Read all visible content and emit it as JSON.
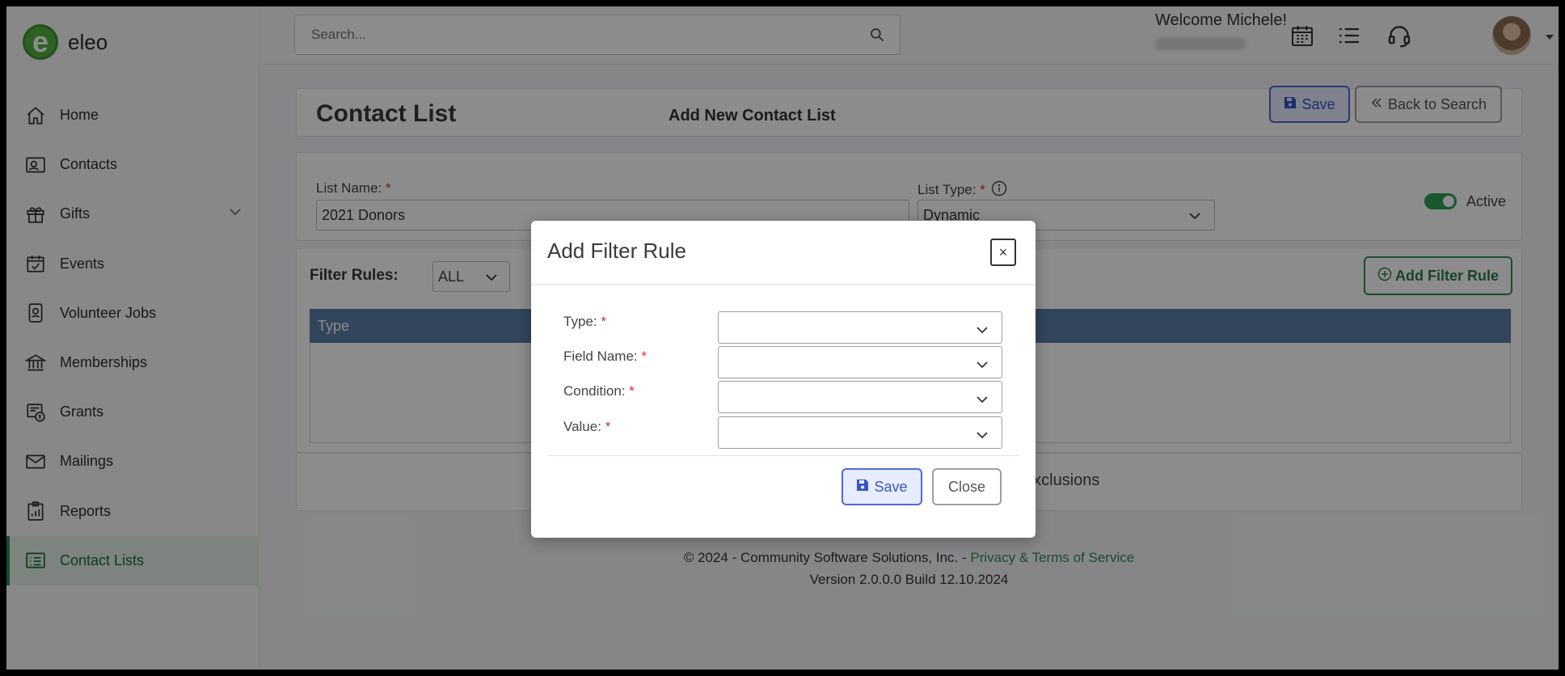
{
  "header": {
    "search_placeholder": "Search...",
    "welcome": "Welcome Michele!"
  },
  "brand": {
    "name": "eleo",
    "mark": "e"
  },
  "sidebar": {
    "items": [
      {
        "label": "Home",
        "icon": "home-icon"
      },
      {
        "label": "Contacts",
        "icon": "contacts-icon"
      },
      {
        "label": "Gifts",
        "icon": "gift-icon"
      },
      {
        "label": "Events",
        "icon": "calendar-check-icon"
      },
      {
        "label": "Volunteer Jobs",
        "icon": "id-badge-icon"
      },
      {
        "label": "Memberships",
        "icon": "bank-icon"
      },
      {
        "label": "Grants",
        "icon": "grant-icon"
      },
      {
        "label": "Mailings",
        "icon": "envelope-icon"
      },
      {
        "label": "Reports",
        "icon": "clipboard-chart-icon"
      },
      {
        "label": "Contact Lists",
        "icon": "list-icon"
      }
    ]
  },
  "page": {
    "title": "Contact List",
    "subtitle": "Add New Contact List",
    "save_label": "Save",
    "back_label": "Back to Search"
  },
  "form": {
    "list_name_label": "List Name:",
    "list_name_value": "2021 Donors",
    "list_type_label": "List Type:",
    "list_type_value": "Dynamic",
    "active_label": "Active",
    "required_mark": "*"
  },
  "filters": {
    "label": "Filter Rules:",
    "match_value": "ALL",
    "add_rule_label": "Add Filter Rule",
    "table_header": "Type"
  },
  "exclusions_text": "exclusions",
  "footer": {
    "copyright": "© 2024 - Community Software Solutions, Inc. - ",
    "privacy_link": "Privacy & Terms of Service",
    "version": "Version 2.0.0.0 Build 12.10.2024"
  },
  "modal": {
    "title": "Add Filter Rule",
    "close_x": "×",
    "fields": [
      {
        "label": "Type:"
      },
      {
        "label": "Field Name:"
      },
      {
        "label": "Condition:"
      },
      {
        "label": "Value:"
      }
    ],
    "save_label": "Save",
    "close_label": "Close"
  },
  "colors": {
    "brand_green": "#52b141",
    "primary_blue": "#4d6bd6",
    "table_header": "#5b7fa8",
    "required_red": "#d32f2f"
  }
}
